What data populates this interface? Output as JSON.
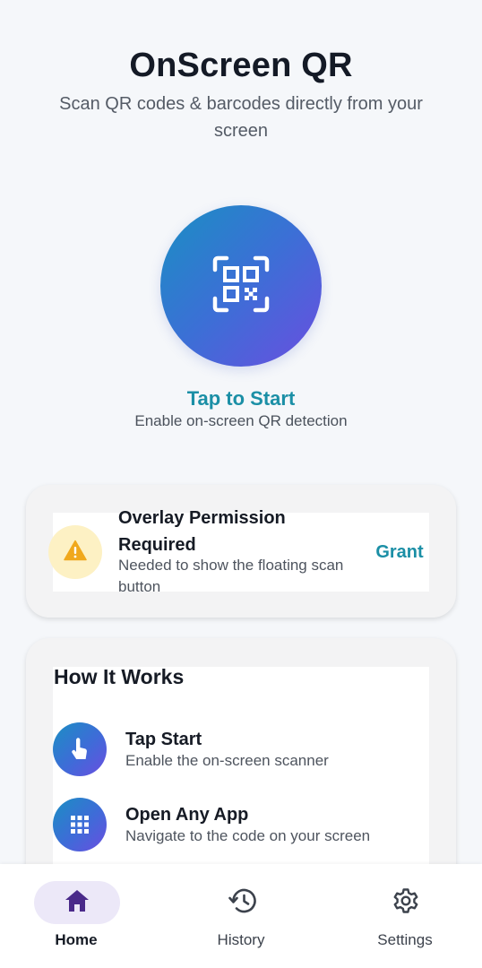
{
  "header": {
    "title": "OnScreen QR",
    "subtitle": "Scan QR codes & barcodes directly from your screen"
  },
  "start": {
    "icon": "qr-scan-icon",
    "label": "Tap to Start",
    "description": "Enable on-screen QR detection"
  },
  "permission_card": {
    "icon": "warning-icon",
    "title": "Overlay Permission Required",
    "description": "Needed to show the floating scan button",
    "action_label": "Grant"
  },
  "how_it_works": {
    "title": "How It Works",
    "steps": [
      {
        "icon": "touch-icon",
        "title": "Tap Start",
        "description": "Enable the on-screen scanner"
      },
      {
        "icon": "apps-grid-icon",
        "title": "Open Any App",
        "description": "Navigate to the code on your screen"
      }
    ]
  },
  "bottom_nav": {
    "items": [
      {
        "icon": "home-icon",
        "label": "Home",
        "active": true
      },
      {
        "icon": "history-icon",
        "label": "History",
        "active": false
      },
      {
        "icon": "settings-icon",
        "label": "Settings",
        "active": false
      }
    ]
  },
  "colors": {
    "accent": "#1b8fa6",
    "gradient_start": "#1a8fc3",
    "gradient_end": "#6a4ee0",
    "warning": "#f0a81c",
    "nav_active": "#4a2a8a"
  }
}
